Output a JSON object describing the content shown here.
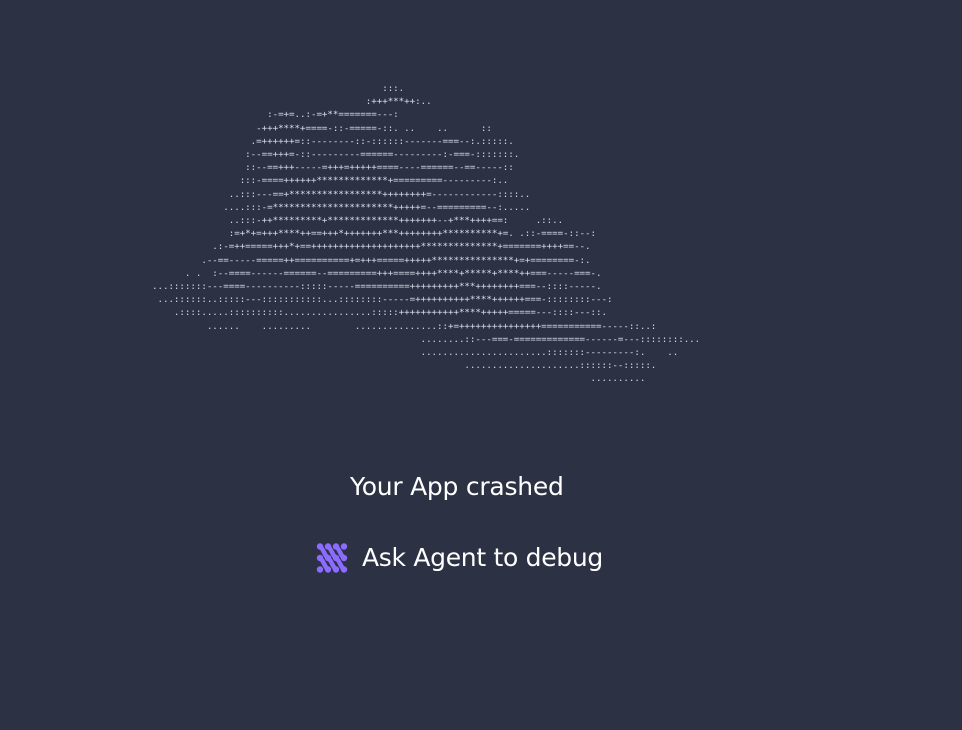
{
  "ascii_art": [
    "                                          :::.",
    "                                       :+++***++:..",
    "                     :-=+=..:-=+**=======---:",
    "                   -+++****+====-::-=====-::. ..    ..      ::",
    "                  .=++++++=::--------::-::::::-------===--:.:::::.",
    "                 :--==+++=-::---------======---------:-===-:::::::.",
    "                 ::--==+++-----=+++=+++++====----======--==-----::",
    "                :::-====++++++*************+=========---------:..",
    "              ..:::---==+*****************++++++++=------------::::..",
    "             ....:::-=**********************+++++=--=========--:.....",
    "              ..:::-++*********+*************+++++++--+***++++==:     .::..",
    "              :=+*+=+++****++==+++*+++++++***++++++++**********+=. .::-====-::--:",
    "           .:-=++=====+++*+==++++++++++++++++++++**************+=======++++==--.",
    "         .--==-----=====++==========+=+++=====+++++***************+=+========-:.",
    "      . .  :--====------======--=========+++====++++****+*****+****++===-----===-.",
    "...:::::::---====----------:::::-----==========+++++++++***++++++++===--::::-----.",
    " ...::::::..:::::---:::::::::::...::::::::-----=++++++++++****++++++===-::::::::---:",
    "    .::::.....::::::::::................:::::+++++++++++****+++++=====---::::---::.",
    "          ......    .........        ...............::+=+++++++++++++++===========-----::..:",
    "                                                 ........::---===-=============------=---::::::::...",
    "                                                 .......................:::::::---------:.    ..",
    "                                                         .....................::::::--:::::.",
    "                                                                                ..........",
    ""
  ],
  "crash": {
    "title": "Your App crashed",
    "action_label": "Ask Agent to debug"
  },
  "colors": {
    "background": "#2c3244",
    "text": "#ffffff",
    "ascii": "#dfe4ef",
    "agent_icon": "#8b6cff"
  },
  "icons": {
    "agent": "agent-logo-icon"
  }
}
